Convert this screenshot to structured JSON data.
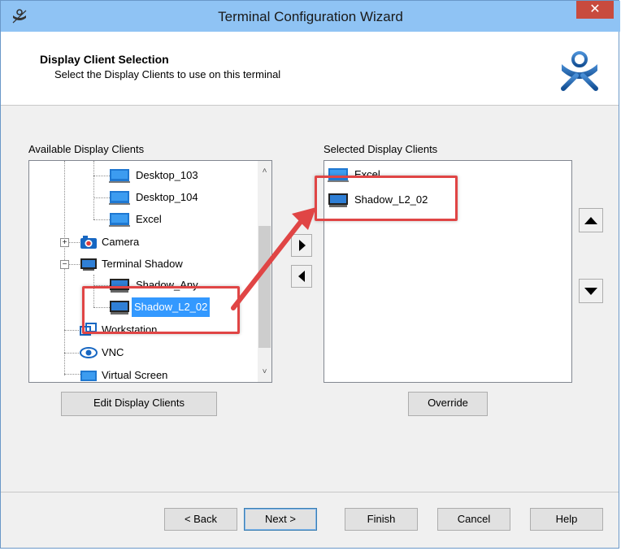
{
  "window": {
    "title": "Terminal Configuration Wizard",
    "close_glyph": "✕"
  },
  "header": {
    "title": "Display Client Selection",
    "subtitle": "Select the Display Clients to use on this terminal"
  },
  "available": {
    "label": "Available Display Clients",
    "items": [
      {
        "label": "Desktop_103",
        "icon": "desktop-icon"
      },
      {
        "label": "Desktop_104",
        "icon": "desktop-icon"
      },
      {
        "label": "Excel",
        "icon": "excel-icon"
      },
      {
        "label": "Camera",
        "icon": "camera-icon",
        "expander": "+"
      },
      {
        "label": "Terminal Shadow",
        "icon": "terminal-shadow-icon",
        "expander": "−"
      },
      {
        "label": "Shadow_Any",
        "icon": "shadow-icon"
      },
      {
        "label": "Shadow_L2_02",
        "icon": "shadow-icon",
        "selected": true
      },
      {
        "label": "Workstation",
        "icon": "workstation-icon"
      },
      {
        "label": "VNC",
        "icon": "vnc-icon"
      },
      {
        "label": "Virtual Screen",
        "icon": "virtual-screen-icon"
      }
    ],
    "edit_button": "Edit Display Clients"
  },
  "selected": {
    "label": "Selected Display Clients",
    "items": [
      {
        "label": "Excel",
        "icon": "excel-icon"
      },
      {
        "label": "Shadow_L2_02",
        "icon": "shadow-icon"
      }
    ],
    "override_button": "Override"
  },
  "footer": {
    "back": "< Back",
    "next": "Next >",
    "finish": "Finish",
    "cancel": "Cancel",
    "help": "Help"
  },
  "colors": {
    "titlebar": "#8fc3f4",
    "selection": "#3399ff",
    "annotation": "#e04545"
  }
}
